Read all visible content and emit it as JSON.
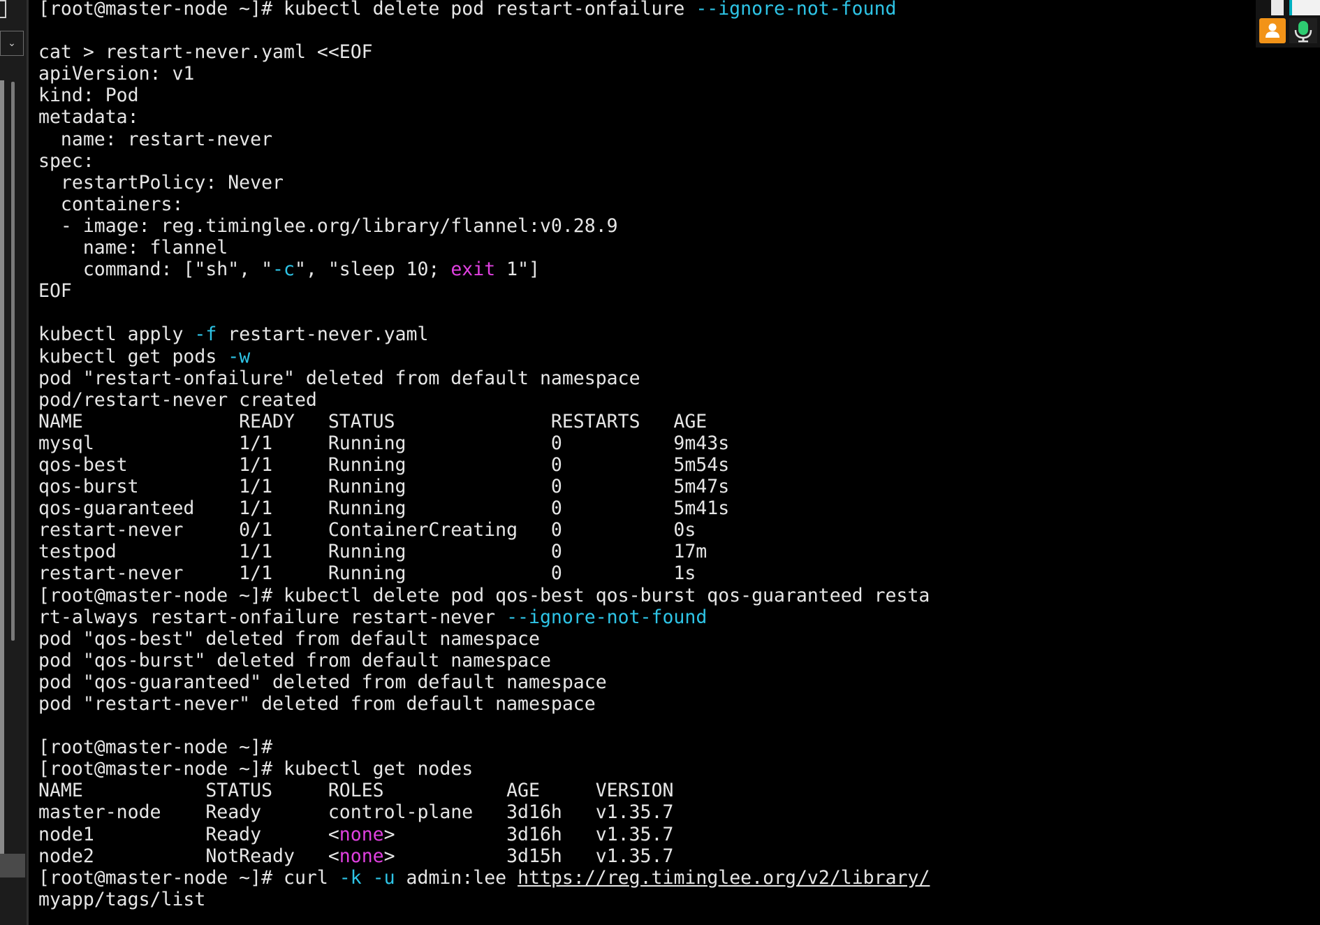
{
  "window": {
    "collapse_glyph": "⌄"
  },
  "colors": {
    "background": "#000000",
    "foreground": "#e6e6e6",
    "flag": "#2ec4e6",
    "keyword": "#e040e0"
  },
  "icons": {
    "user": "user-icon",
    "mic": "microphone-icon"
  },
  "terminal": {
    "lines": [
      [
        {
          "t": "[root@master-node ~]# kubectl delete pod restart-onfailure "
        },
        {
          "t": "--ignore-not-found",
          "c": "flag"
        }
      ],
      [],
      [
        {
          "t": "cat > restart-never.yaml <<EOF"
        }
      ],
      [
        {
          "t": "apiVersion: v1"
        }
      ],
      [
        {
          "t": "kind: Pod"
        }
      ],
      [
        {
          "t": "metadata:"
        }
      ],
      [
        {
          "t": "  name: restart-never"
        }
      ],
      [
        {
          "t": "spec:"
        }
      ],
      [
        {
          "t": "  restartPolicy: Never"
        }
      ],
      [
        {
          "t": "  containers:"
        }
      ],
      [
        {
          "t": "  - image: reg.timinglee.org/library/flannel:v0.28.9"
        }
      ],
      [
        {
          "t": "    name: flannel"
        }
      ],
      [
        {
          "t": "    command: [\"sh\", \""
        },
        {
          "t": "-c",
          "c": "flag"
        },
        {
          "t": "\", \"sleep 10; "
        },
        {
          "t": "exit",
          "c": "keyword"
        },
        {
          "t": " 1\"]"
        }
      ],
      [
        {
          "t": "EOF"
        }
      ],
      [],
      [
        {
          "t": "kubectl apply "
        },
        {
          "t": "-f",
          "c": "flag"
        },
        {
          "t": " restart-never.yaml"
        }
      ],
      [
        {
          "t": "kubectl get pods "
        },
        {
          "t": "-w",
          "c": "flag"
        }
      ],
      [
        {
          "t": "pod \"restart-onfailure\" deleted from default namespace"
        }
      ],
      [
        {
          "t": "pod/restart-never created"
        }
      ],
      [
        {
          "t": "NAME              READY   STATUS              RESTARTS   AGE"
        }
      ],
      [
        {
          "t": "mysql             1/1     Running             0          9m43s"
        }
      ],
      [
        {
          "t": "qos-best          1/1     Running             0          5m54s"
        }
      ],
      [
        {
          "t": "qos-burst         1/1     Running             0          5m47s"
        }
      ],
      [
        {
          "t": "qos-guaranteed    1/1     Running             0          5m41s"
        }
      ],
      [
        {
          "t": "restart-never     0/1     ContainerCreating   0          0s"
        }
      ],
      [
        {
          "t": "testpod           1/1     Running             0          17m"
        }
      ],
      [
        {
          "t": "restart-never     1/1     Running             0          1s"
        }
      ],
      [
        {
          "t": "[root@master-node ~]# kubectl delete pod qos-best qos-burst qos-guaranteed resta"
        }
      ],
      [
        {
          "t": "rt-always restart-onfailure restart-never "
        },
        {
          "t": "--ignore-not-found",
          "c": "flag"
        }
      ],
      [
        {
          "t": "pod \"qos-best\" deleted from default namespace"
        }
      ],
      [
        {
          "t": "pod \"qos-burst\" deleted from default namespace"
        }
      ],
      [
        {
          "t": "pod \"qos-guaranteed\" deleted from default namespace"
        }
      ],
      [
        {
          "t": "pod \"restart-never\" deleted from default namespace"
        }
      ],
      [],
      [
        {
          "t": "[root@master-node ~]#"
        }
      ],
      [
        {
          "t": "[root@master-node ~]# kubectl get nodes"
        }
      ],
      [
        {
          "t": "NAME           STATUS     ROLES           AGE     VERSION"
        }
      ],
      [
        {
          "t": "master-node    Ready      control-plane   3d16h   v1.35.7"
        }
      ],
      [
        {
          "t": "node1          Ready      <"
        },
        {
          "t": "none",
          "c": "keyword"
        },
        {
          "t": ">          3d16h   v1.35.7"
        }
      ],
      [
        {
          "t": "node2          NotReady   <"
        },
        {
          "t": "none",
          "c": "keyword"
        },
        {
          "t": ">          3d15h   v1.35.7"
        }
      ],
      [
        {
          "t": "[root@master-node ~]# curl "
        },
        {
          "t": "-k",
          "c": "flag"
        },
        {
          "t": " "
        },
        {
          "t": "-u",
          "c": "flag"
        },
        {
          "t": " admin:lee "
        },
        {
          "t": "https://reg.timinglee.org/v2/library/",
          "c": "url"
        }
      ],
      [
        {
          "t": "myapp/tags/list"
        }
      ]
    ]
  }
}
